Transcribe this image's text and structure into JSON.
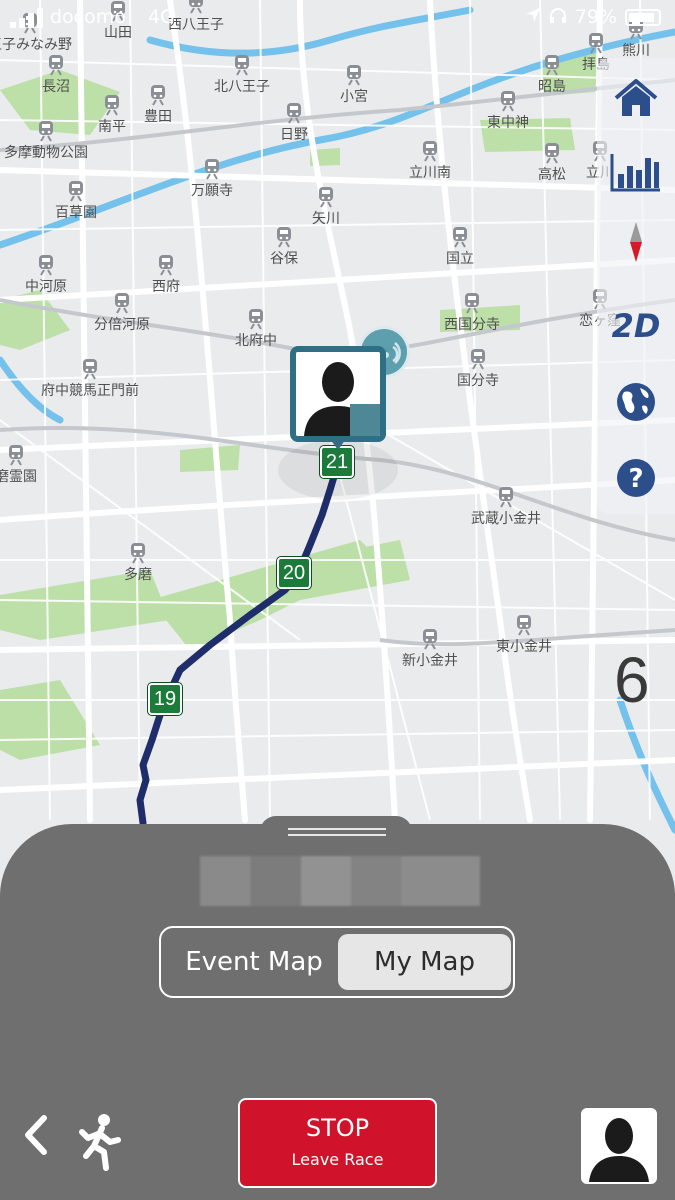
{
  "status_bar": {
    "carrier": "docomo",
    "network": "4G",
    "battery": "79%"
  },
  "map": {
    "stations": [
      {
        "name": "王子みなみ野"
      },
      {
        "name": "山田"
      },
      {
        "name": "西八王子"
      },
      {
        "name": "長沼"
      },
      {
        "name": "北八王子"
      },
      {
        "name": "小宮"
      },
      {
        "name": "昭島"
      },
      {
        "name": "拝島"
      },
      {
        "name": "熊川"
      },
      {
        "name": "南平"
      },
      {
        "name": "豊田"
      },
      {
        "name": "日野"
      },
      {
        "name": "東中神"
      },
      {
        "name": "多摩動物公園"
      },
      {
        "name": "万願寺"
      },
      {
        "name": "立川南"
      },
      {
        "name": "高松"
      },
      {
        "name": "立川"
      },
      {
        "name": "百草園"
      },
      {
        "name": "矢川"
      },
      {
        "name": "谷保"
      },
      {
        "name": "国立"
      },
      {
        "name": "中河原"
      },
      {
        "name": "西府"
      },
      {
        "name": "分倍河原"
      },
      {
        "name": "北府中"
      },
      {
        "name": "西国分寺"
      },
      {
        "name": "恋ヶ窪"
      },
      {
        "name": "府中競馬正門前"
      },
      {
        "name": "国分寺"
      },
      {
        "name": "磨霊園"
      },
      {
        "name": "武蔵小金井"
      },
      {
        "name": "多磨"
      },
      {
        "name": "新小金井"
      },
      {
        "name": "東小金井"
      }
    ],
    "km_markers": [
      "21",
      "20",
      "19"
    ],
    "route_color": "#1f2d6b",
    "marker_color": "#1c7a3a",
    "countdown": "6"
  },
  "toolbar": {
    "home_icon": "home-icon",
    "stats_icon": "bar-chart-icon",
    "compass_icon": "compass-icon",
    "view_mode": "2D",
    "globe_icon": "globe-icon",
    "help_icon": "help-icon"
  },
  "panel": {
    "tabs": [
      "Event Map",
      "My Map"
    ],
    "selected_tab": "My Map",
    "stop_label": "STOP",
    "stop_sub": "Leave Race",
    "stop_color": "#d0122b"
  }
}
